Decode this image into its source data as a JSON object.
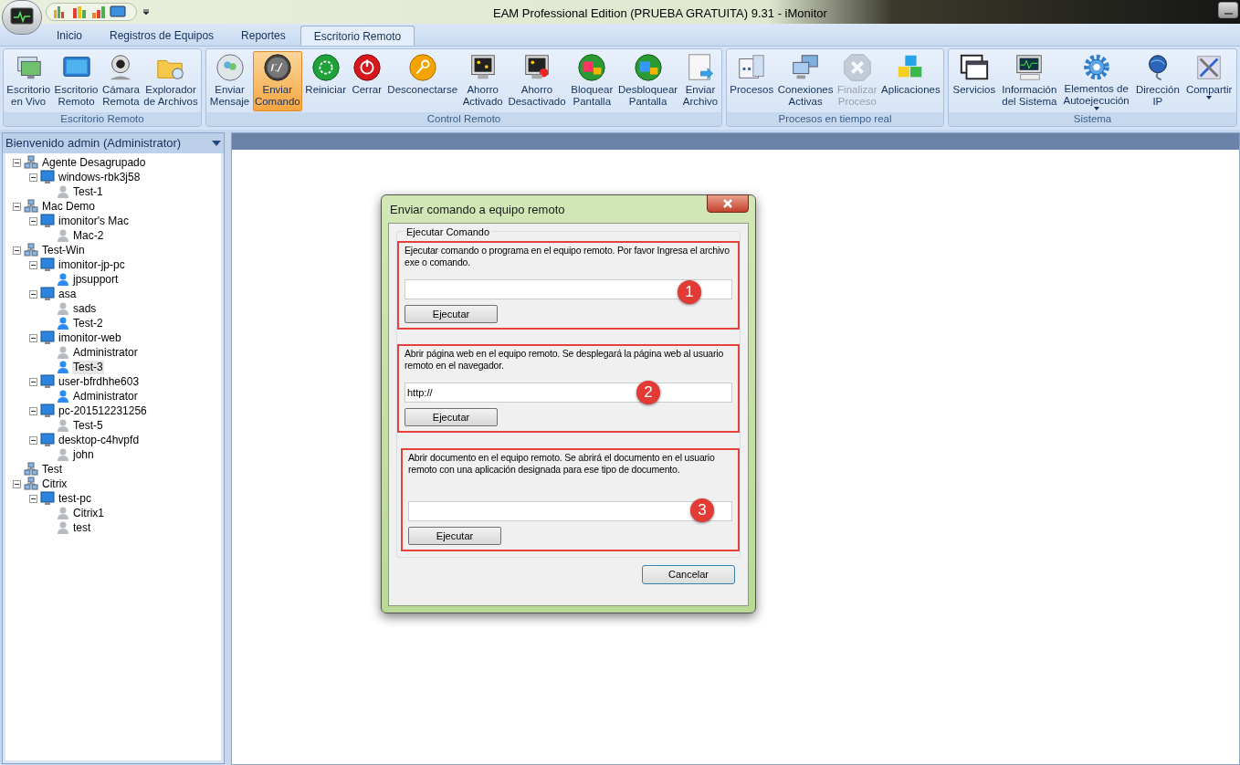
{
  "window": {
    "title": "EAM Professional Edition (PRUEBA GRATUITA) 9.31 - iMonitor"
  },
  "tabs": [
    {
      "label": "Inicio",
      "selected": false
    },
    {
      "label": "Registros de Equipos",
      "selected": false
    },
    {
      "label": "Reportes",
      "selected": false
    },
    {
      "label": "Escritorio Remoto",
      "selected": true
    }
  ],
  "ribbon": {
    "groups": [
      {
        "label": "Escritorio Remoto",
        "buttons": [
          {
            "lines": [
              "Escritorio",
              "en Vivo"
            ],
            "disabled": false,
            "selected": false,
            "dropdown": false
          },
          {
            "lines": [
              "Escritorio",
              "Remoto"
            ],
            "disabled": false,
            "selected": false,
            "dropdown": false
          },
          {
            "lines": [
              "Cámara",
              "Remota"
            ],
            "disabled": false,
            "selected": false,
            "dropdown": false
          },
          {
            "lines": [
              "Explorador",
              "de Archivos"
            ],
            "disabled": false,
            "selected": false,
            "dropdown": false
          }
        ]
      },
      {
        "label": "Control Remoto",
        "buttons": [
          {
            "lines": [
              "Enviar",
              "Mensaje"
            ],
            "disabled": false,
            "selected": false,
            "dropdown": false
          },
          {
            "lines": [
              "Enviar",
              "Comando"
            ],
            "disabled": false,
            "selected": true,
            "dropdown": false
          },
          {
            "lines": [
              "Reiniciar"
            ],
            "disabled": false,
            "selected": false,
            "dropdown": false
          },
          {
            "lines": [
              "Cerrar"
            ],
            "disabled": false,
            "selected": false,
            "dropdown": false
          },
          {
            "lines": [
              "Desconectarse"
            ],
            "disabled": false,
            "selected": false,
            "dropdown": false
          },
          {
            "lines": [
              "Ahorro",
              "Activado"
            ],
            "disabled": false,
            "selected": false,
            "dropdown": false
          },
          {
            "lines": [
              "Ahorro",
              "Desactivado"
            ],
            "disabled": false,
            "selected": false,
            "dropdown": false
          },
          {
            "lines": [
              "Bloquear",
              "Pantalla"
            ],
            "disabled": false,
            "selected": false,
            "dropdown": false
          },
          {
            "lines": [
              "Desbloquear",
              "Pantalla"
            ],
            "disabled": false,
            "selected": false,
            "dropdown": false
          },
          {
            "lines": [
              "Enviar",
              "Archivo"
            ],
            "disabled": false,
            "selected": false,
            "dropdown": false
          }
        ]
      },
      {
        "label": "Procesos en tiempo real",
        "buttons": [
          {
            "lines": [
              "Procesos"
            ],
            "disabled": false,
            "selected": false,
            "dropdown": false
          },
          {
            "lines": [
              "Conexiones",
              "Activas"
            ],
            "disabled": false,
            "selected": false,
            "dropdown": false
          },
          {
            "lines": [
              "Finalizar",
              "Proceso"
            ],
            "disabled": true,
            "selected": false,
            "dropdown": false
          },
          {
            "lines": [
              "Aplicaciones"
            ],
            "disabled": false,
            "selected": false,
            "dropdown": false
          }
        ]
      },
      {
        "label": "Sistema",
        "buttons": [
          {
            "lines": [
              "Servicios"
            ],
            "disabled": false,
            "selected": false,
            "dropdown": false
          },
          {
            "lines": [
              "Información",
              "del Sistema"
            ],
            "disabled": false,
            "selected": false,
            "dropdown": false
          },
          {
            "lines": [
              "Elementos de",
              "Autoejecución"
            ],
            "disabled": false,
            "selected": false,
            "dropdown": true
          },
          {
            "lines": [
              "Dirección",
              "IP"
            ],
            "disabled": false,
            "selected": false,
            "dropdown": false
          },
          {
            "lines": [
              "Compartir"
            ],
            "disabled": false,
            "selected": false,
            "dropdown": true
          }
        ]
      }
    ]
  },
  "sidebar": {
    "header": "Bienvenido admin (Administrator)",
    "tree": [
      {
        "kind": "group",
        "label": "Agente Desagrupado",
        "children": [
          {
            "kind": "computer",
            "label": "windows-rbk3j58",
            "children": [
              {
                "kind": "user",
                "label": "Test-1",
                "online": false,
                "selected": false
              }
            ]
          }
        ]
      },
      {
        "kind": "group",
        "label": "Mac Demo",
        "children": [
          {
            "kind": "computer",
            "label": "imonitor's Mac",
            "children": [
              {
                "kind": "user",
                "label": "Mac-2",
                "online": false,
                "selected": false
              }
            ]
          }
        ]
      },
      {
        "kind": "group",
        "label": "Test-Win",
        "children": [
          {
            "kind": "computer",
            "label": "imonitor-jp-pc",
            "children": [
              {
                "kind": "user",
                "label": "jpsupport",
                "online": true,
                "selected": false
              }
            ]
          },
          {
            "kind": "computer",
            "label": "asa",
            "children": [
              {
                "kind": "user",
                "label": "sads",
                "online": false,
                "selected": false
              },
              {
                "kind": "user",
                "label": "Test-2",
                "online": true,
                "selected": false
              }
            ]
          },
          {
            "kind": "computer",
            "label": "imonitor-web",
            "children": [
              {
                "kind": "user",
                "label": "Administrator",
                "online": false,
                "selected": false
              },
              {
                "kind": "user",
                "label": "Test-3",
                "online": true,
                "selected": true
              }
            ]
          },
          {
            "kind": "computer",
            "label": "user-bfrdhhe603",
            "children": [
              {
                "kind": "user",
                "label": "Administrator",
                "online": true,
                "selected": false
              }
            ]
          },
          {
            "kind": "computer",
            "label": "pc-201512231256",
            "children": [
              {
                "kind": "user",
                "label": "Test-5",
                "online": false,
                "selected": false
              }
            ]
          },
          {
            "kind": "computer",
            "label": "desktop-c4hvpfd",
            "children": [
              {
                "kind": "user",
                "label": "john",
                "online": false,
                "selected": false
              }
            ]
          }
        ]
      },
      {
        "kind": "group",
        "label": "Test"
      },
      {
        "kind": "group",
        "label": "Citrix",
        "children": [
          {
            "kind": "computer",
            "label": "test-pc",
            "children": [
              {
                "kind": "user",
                "label": "Citrix1",
                "online": false,
                "selected": false
              },
              {
                "kind": "user",
                "label": "test",
                "online": false,
                "selected": false
              }
            ]
          }
        ]
      }
    ]
  },
  "dialog": {
    "title": "Enviar comando a equipo remoto",
    "group_label": "Ejecutar Comando",
    "sections": [
      {
        "text": "Ejecutar comando o programa en el equipo remoto. Por favor Ingresa el archivo exe o comando.",
        "button": "Ejecutar",
        "marker": "1"
      },
      {
        "text": "Abrir página web en el equipo remoto. Se desplegará la página web al usuario remoto en el navegador.",
        "value": "http://",
        "button": "Ejecutar",
        "marker": "2"
      },
      {
        "text": "Abrir documento en el equipo remoto. Se abrirá el documento en el usuario remoto con una aplicación designada para ese tipo de documento.",
        "button": "Ejecutar",
        "marker": "3"
      }
    ],
    "cancel": "Cancelar"
  }
}
